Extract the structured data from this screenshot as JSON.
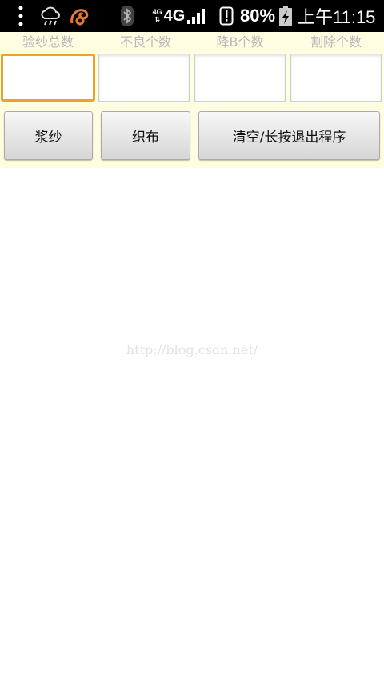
{
  "status_bar": {
    "network_small": "4G",
    "network": "4G",
    "battery_percent": "80%",
    "time": "上午11:15",
    "icons": [
      "menu-dots-icon",
      "weather-cloud-icon",
      "uc-browser-icon",
      "bluetooth-icon",
      "signal-icon",
      "alert-icon",
      "battery-charging-icon"
    ]
  },
  "form": {
    "columns": [
      {
        "label": "验纱总数",
        "value": ""
      },
      {
        "label": "不良个数",
        "value": ""
      },
      {
        "label": "降B个数",
        "value": ""
      },
      {
        "label": "割除个数",
        "value": ""
      }
    ],
    "focused_index": 0
  },
  "buttons": {
    "sizing": "浆纱",
    "weaving": "织布",
    "clear_exit": "清空/长按退出程序"
  },
  "watermark": "http://blog.csdn.net/",
  "colors": {
    "panel_bg": "#fefde2",
    "focus": "#f0a030",
    "uc_orange": "#e8782a"
  }
}
